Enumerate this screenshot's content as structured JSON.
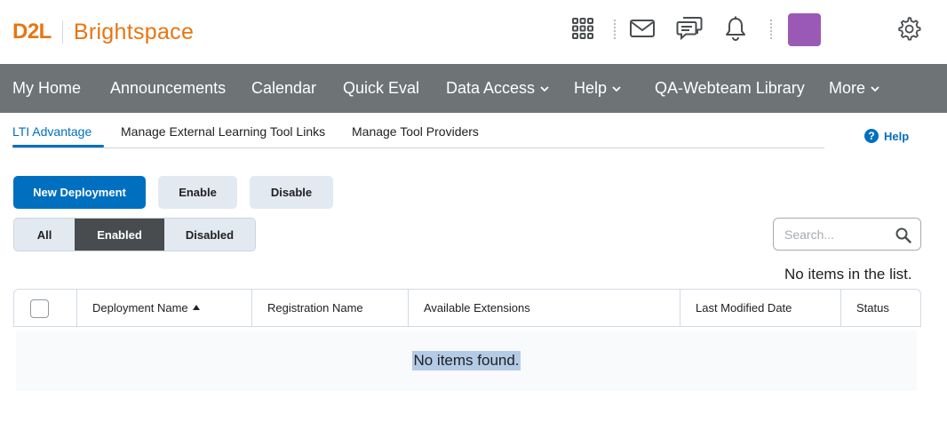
{
  "branding": {
    "d2l": "D2L",
    "product": "Brightspace",
    "brand_color": "#e87511"
  },
  "header": {
    "icons": [
      "waffle-icon",
      "mail-icon",
      "chat-icon",
      "bell-icon",
      "gear-icon"
    ],
    "avatar_color": "#9b59b6"
  },
  "nav": {
    "items": [
      {
        "label": "My Home",
        "has_menu": false
      },
      {
        "label": "Announcements",
        "has_menu": false
      },
      {
        "label": "Calendar",
        "has_menu": false
      },
      {
        "label": "Quick Eval",
        "has_menu": false
      },
      {
        "label": "Data Access",
        "has_menu": true
      },
      {
        "label": "Help",
        "has_menu": true
      },
      {
        "label": "QA-Webteam Library",
        "has_menu": false
      },
      {
        "label": "More",
        "has_menu": true
      }
    ],
    "background": "#6e7376"
  },
  "tabs": {
    "items": [
      {
        "label": "LTI Advantage",
        "active": true
      },
      {
        "label": "Manage External Learning Tool Links",
        "active": false
      },
      {
        "label": "Manage Tool Providers",
        "active": false
      }
    ],
    "help_label": "Help"
  },
  "actions": {
    "new_deployment": "New Deployment",
    "enable": "Enable",
    "disable": "Disable"
  },
  "filter": {
    "options": [
      "All",
      "Enabled",
      "Disabled"
    ],
    "selected": "Enabled"
  },
  "search": {
    "placeholder": "Search...",
    "value": ""
  },
  "status_message": "No items in the list.",
  "table": {
    "columns": [
      {
        "label": "Deployment Name",
        "sorted": "asc"
      },
      {
        "label": "Registration Name"
      },
      {
        "label": "Available Extensions"
      },
      {
        "label": "Last Modified Date"
      },
      {
        "label": "Status"
      }
    ],
    "empty_text": "No items found."
  },
  "colors": {
    "primary": "#006fbf",
    "selected_filter": "#494c4e"
  }
}
